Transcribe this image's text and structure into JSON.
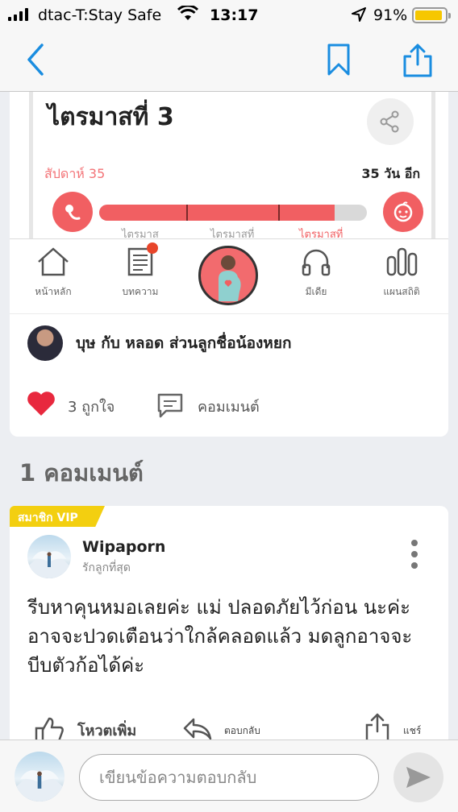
{
  "status_bar": {
    "carrier": "dtac-T:Stay Safe",
    "time": "13:17",
    "battery_percent": "91%",
    "battery_level": 0.91
  },
  "nav": {
    "back_icon": "chevron-left-icon",
    "bookmark_icon": "bookmark-icon",
    "share_icon": "share-icon",
    "accent_color": "#1a8de0"
  },
  "pregnancy_widget": {
    "title": "ไตรมาสที่ 3",
    "week_label": "สัปดาห์ 35",
    "days_left": "35 วัน อีก",
    "progress": 0.88,
    "segment_labels": [
      "ไตรมาส",
      "ไตรมาสที่",
      "ไตรมาสที่"
    ],
    "accent_color": "#f15f62"
  },
  "tabs": [
    {
      "label": "หน้าหลัก",
      "icon": "home-icon"
    },
    {
      "label": "บทความ",
      "icon": "article-icon"
    },
    {
      "label": "",
      "icon": "pregnancy-avatar-icon"
    },
    {
      "label": "มีเดีย",
      "icon": "headphones-icon"
    },
    {
      "label": "แผนสถิติ",
      "icon": "chart-icon"
    }
  ],
  "post": {
    "author_name": "บุษ กับ หลอด ส่วนลูกชื่อน้องหยก",
    "likes_label": "3 ถูกใจ",
    "comment_label": "คอมเมนต์",
    "like_color": "#e8283e"
  },
  "comments_heading": "1 คอมเมนต์",
  "comment": {
    "badge": "สมาชิก VIP",
    "author": "Wipaporn",
    "subtitle": "รักลูกที่สุด",
    "body": "รีบหาคุนหมอเลยค่ะ แม่ ปลอดภัยไว้ก่อน นะค่ะ อาจจะปวดเตือนว่าใกล้คลอดแล้ว มดลูกอาจจะบีบตัวก้อได้ค่ะ",
    "vote_label": "โหวตเพิ่ม",
    "reply_label": "ตอบกลับ",
    "share_label": "แชร์",
    "badge_color": "#f3cf10"
  },
  "reply_bar": {
    "placeholder": "เขียนข้อความตอบกลับ"
  }
}
